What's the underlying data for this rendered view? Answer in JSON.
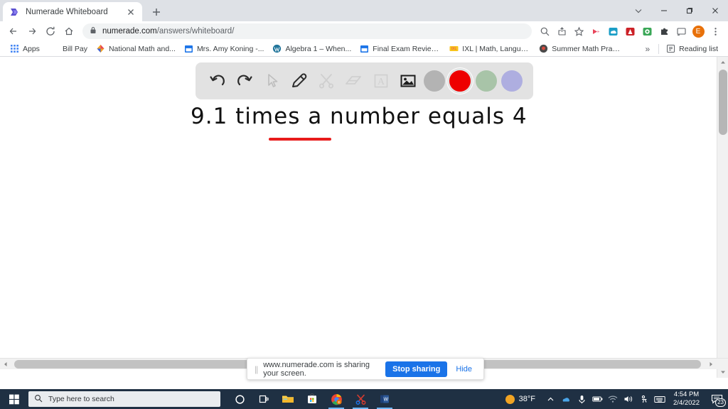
{
  "window": {
    "controls": [
      {
        "name": "chevron-down-icon",
        "glyph": "⌄"
      },
      {
        "name": "minimize-icon",
        "glyph": "—"
      },
      {
        "name": "maximize-icon",
        "glyph": "❐"
      },
      {
        "name": "close-icon",
        "glyph": "✕"
      }
    ]
  },
  "tab": {
    "title": "Numerade Whiteboard",
    "close_glyph": "✕",
    "newtab_glyph": "+"
  },
  "nav": {
    "back_glyph": "←",
    "forward_glyph": "→",
    "reload_glyph": "⟳",
    "home_glyph": "⌂"
  },
  "omnibox": {
    "lock_glyph": "🔒",
    "url_domain": "numerade.com",
    "url_path": "/answers/whiteboard/"
  },
  "toolbar_icons": [
    {
      "name": "search-icon",
      "glyph": "🔍",
      "color": "#5f6368"
    },
    {
      "name": "share-icon",
      "glyph": "⇱",
      "color": "#5f6368"
    },
    {
      "name": "bookmark-star-icon",
      "glyph": "☆",
      "color": "#5f6368"
    },
    {
      "name": "extension-video-icon",
      "glyph": "▶",
      "color": "#e8445a"
    },
    {
      "name": "extension-cloud-icon",
      "glyph": "☁",
      "color": "#1b9ec7"
    },
    {
      "name": "adobe-pdf-icon",
      "glyph": "A",
      "color": "#cc2127"
    },
    {
      "name": "extension-grammar-icon",
      "glyph": "✓",
      "color": "#3aa757"
    },
    {
      "name": "extensions-puzzle-icon",
      "glyph": "🧩",
      "color": "#3c4043"
    },
    {
      "name": "cast-icon",
      "glyph": "⌗",
      "color": "#5f6368"
    }
  ],
  "profile": {
    "initial": "E",
    "color": "#e8710a"
  },
  "menu": {
    "glyph": "⋮"
  },
  "bookmarks": {
    "apps_label": "Apps",
    "items": [
      {
        "label": "Bill Pay",
        "icon": "none",
        "color": "#ffffff"
      },
      {
        "label": "National Math and...",
        "icon": "kite-icon",
        "color": "#f5a623"
      },
      {
        "label": "Mrs. Amy Koning -...",
        "icon": "calendar-icon",
        "color": "#1a73e8"
      },
      {
        "label": "Algebra 1 – When...",
        "icon": "wordpress-icon",
        "color": "#21759b"
      },
      {
        "label": "Final Exam Review -...",
        "icon": "calendar-icon",
        "color": "#1a73e8"
      },
      {
        "label": "IXL | Math, Languag...",
        "icon": "ixl-icon",
        "color": "#f8c41c"
      },
      {
        "label": "Summer Math Pract...",
        "icon": "globe-icon",
        "color": "#4a4a4a"
      }
    ],
    "overflow_glyph": "»",
    "reading_list_label": "Reading list"
  },
  "whiteboard": {
    "tools": [
      {
        "name": "undo-icon",
        "glyph": "↺",
        "state": "enabled"
      },
      {
        "name": "redo-icon",
        "glyph": "↻",
        "state": "enabled"
      },
      {
        "name": "cursor-select-icon",
        "glyph": "➤",
        "state": "disabled"
      },
      {
        "name": "pencil-icon",
        "glyph": "✎",
        "state": "enabled"
      },
      {
        "name": "scissors-icon",
        "glyph": "✂",
        "state": "disabled"
      },
      {
        "name": "eraser-icon",
        "glyph": "▱",
        "state": "disabled"
      },
      {
        "name": "text-icon",
        "glyph": "A",
        "state": "disabled"
      },
      {
        "name": "image-icon",
        "glyph": "🖼",
        "state": "enabled"
      }
    ],
    "colors": [
      {
        "name": "color-swatch-gray",
        "hex": "#b3b3b3",
        "selected": false
      },
      {
        "name": "color-swatch-red",
        "hex": "#ee0000",
        "selected": true
      },
      {
        "name": "color-swatch-green",
        "hex": "#a8c4a8",
        "selected": false
      },
      {
        "name": "color-swatch-purple",
        "hex": "#aeaee0",
        "selected": false
      }
    ],
    "handwriting_text": "9.1 times a number equals 4",
    "underline_color": "#e81b1b"
  },
  "sharebar": {
    "grip_glyph": "||",
    "message": "www.numerade.com is sharing your screen.",
    "stop_label": "Stop sharing",
    "hide_label": "Hide",
    "button_color": "#1a73e8"
  },
  "scrollbars": {
    "v_up_glyph": "▲",
    "v_down_glyph": "▼",
    "h_left_glyph": "◀",
    "h_right_glyph": "▶"
  },
  "taskbar": {
    "start_glyph": "⊞",
    "search_placeholder": "Type here to search",
    "search_icon_glyph": "🔍",
    "items": [
      {
        "name": "cortana-icon",
        "glyph": "◯",
        "active": false
      },
      {
        "name": "task-view-icon",
        "glyph": "❐",
        "active": false
      },
      {
        "name": "file-explorer-icon",
        "glyph": "🗀",
        "active": false
      },
      {
        "name": "microsoft-store-icon",
        "glyph": "🛍",
        "active": false
      },
      {
        "name": "chrome-icon",
        "glyph": "◉",
        "active": true
      },
      {
        "name": "snipping-tool-icon",
        "glyph": "✂",
        "active": true
      },
      {
        "name": "word-icon",
        "glyph": "W",
        "active": true
      }
    ],
    "weather_temp": "38°F",
    "tray": [
      {
        "name": "show-hidden-icons-icon",
        "glyph": "⌃"
      },
      {
        "name": "onedrive-icon",
        "glyph": "☁"
      },
      {
        "name": "microphone-icon",
        "glyph": "🎤"
      },
      {
        "name": "battery-icon",
        "glyph": "▬"
      },
      {
        "name": "wifi-icon",
        "glyph": "◥"
      },
      {
        "name": "volume-icon",
        "glyph": "🔊"
      },
      {
        "name": "accessibility-icon",
        "glyph": "♿"
      },
      {
        "name": "keyboard-icon",
        "glyph": "⌨"
      }
    ],
    "time": "4:54 PM",
    "date": "2/4/2022",
    "notification_count": "23"
  }
}
